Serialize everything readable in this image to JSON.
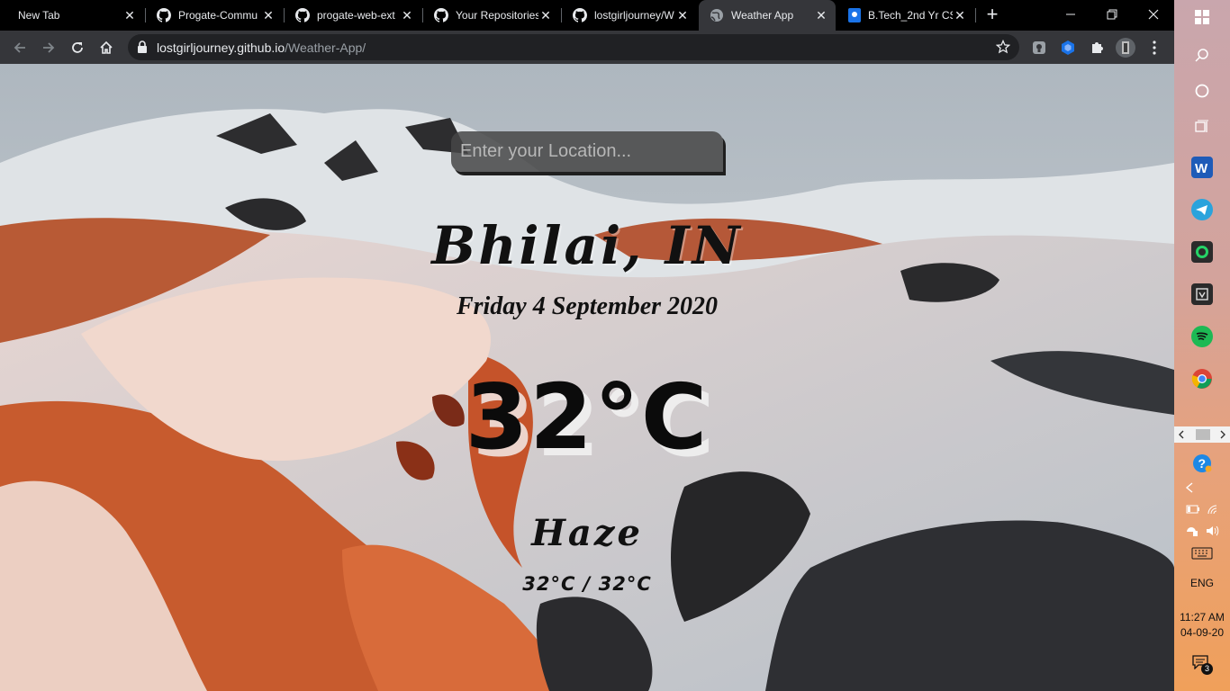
{
  "browser": {
    "tabs": [
      {
        "title": "New Tab",
        "icon": "none",
        "active": false
      },
      {
        "title": "Progate-Commu",
        "icon": "github-icon",
        "active": false
      },
      {
        "title": "progate-web-ext",
        "icon": "github-icon",
        "active": false
      },
      {
        "title": "Your Repositories",
        "icon": "github-icon",
        "active": false
      },
      {
        "title": "lostgirljourney/W",
        "icon": "github-icon",
        "active": false
      },
      {
        "title": "Weather App",
        "icon": "globe-icon",
        "active": true
      },
      {
        "title": "B.Tech_2nd Yr CS",
        "icon": "docs-icon",
        "active": false
      }
    ],
    "url_host": "lostgirljourney.github.io",
    "url_path": "/Weather-App/",
    "colors": {
      "tabstrip": "#000000",
      "toolbar": "#35363a",
      "omnibox": "#202124"
    }
  },
  "weather": {
    "search_placeholder": "Enter your Location...",
    "city": "Bhilai, IN",
    "date": "Friday 4 September 2020",
    "temperature": "32°C",
    "condition": "Haze",
    "hi_low": "32°C / 32°C"
  },
  "taskbar": {
    "apps": [
      "windows-start-icon",
      "search-icon",
      "cortana-icon",
      "task-view-icon",
      "word-icon",
      "telegram-icon",
      "whatsapp-icon",
      "unknown-app-icon",
      "spotify-icon",
      "chrome-icon"
    ],
    "language": "ENG",
    "time": "11:27 AM",
    "date": "04-09-20",
    "notification_count": "3"
  }
}
